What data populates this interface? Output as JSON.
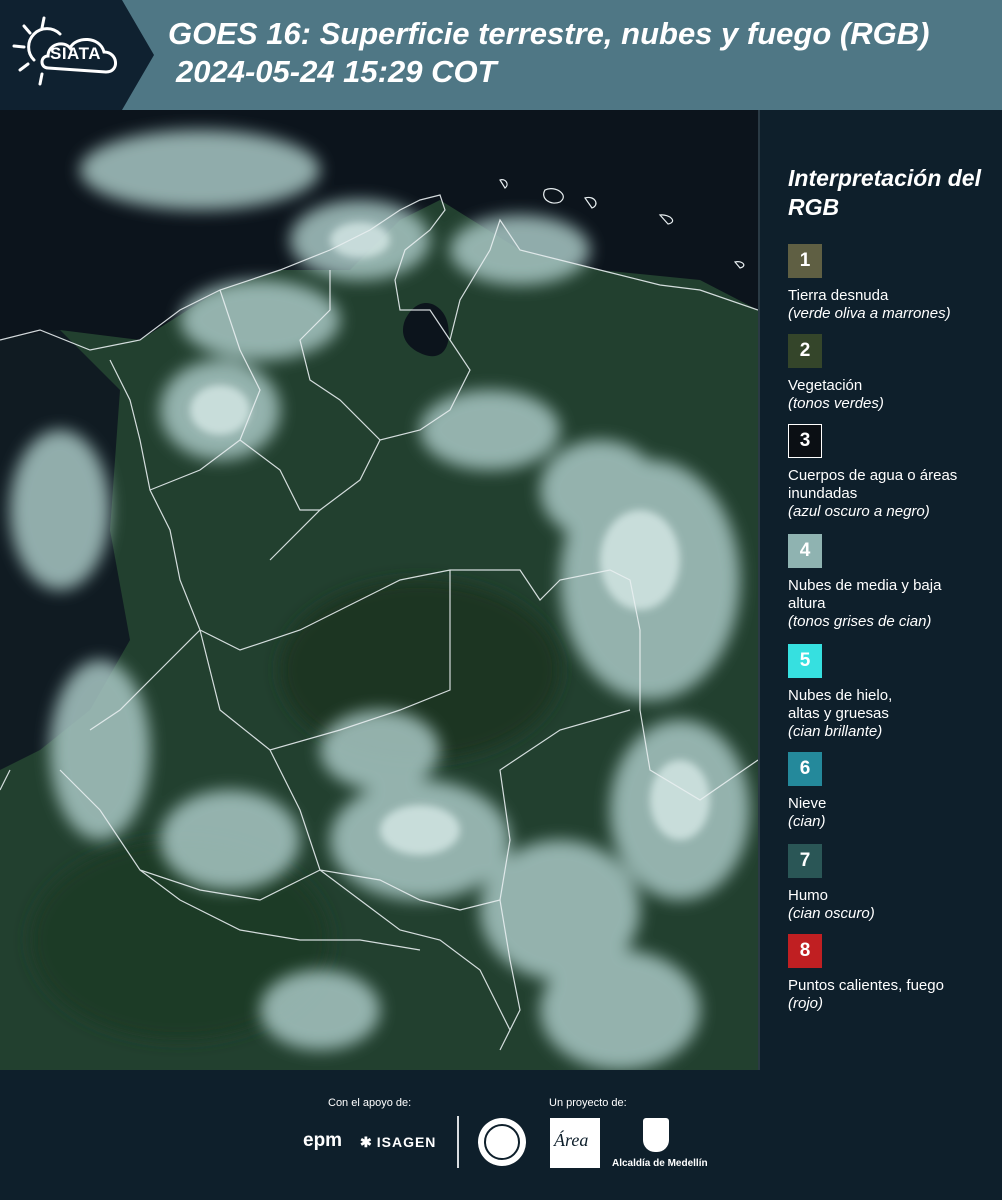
{
  "header": {
    "logo": "SIATA",
    "title": "GOES 16: Superficie terrestre, nubes y fuego (RGB)",
    "datetime": "2024-05-24 15:29 COT"
  },
  "legend": {
    "title": "Interpretación del RGB",
    "items": [
      {
        "number": "1",
        "label": "Tierra desnuda",
        "hint": "(verde oliva a marrones)",
        "color": "#5f5f43"
      },
      {
        "number": "2",
        "label": "Vegetación",
        "hint": "(tonos verdes)",
        "color": "#34452a"
      },
      {
        "number": "3",
        "label": "Cuerpos de agua o áreas inundadas",
        "hint": "(azul oscuro a negro)",
        "color": "#0b0f14"
      },
      {
        "number": "4",
        "label": "Nubes de media y baja altura",
        "hint": "(tonos grises de cian)",
        "color": "#8fb3b1"
      },
      {
        "number": "5",
        "label": "Nubes de hielo, altas y gruesas",
        "hint": "(cian brillante)",
        "color": "#36e0e0"
      },
      {
        "number": "6",
        "label": "Nieve",
        "hint": "(cian)",
        "color": "#24899b"
      },
      {
        "number": "7",
        "label": "Humo",
        "hint": "(cian oscuro)",
        "color": "#2a5656"
      },
      {
        "number": "8",
        "label": "Puntos calientes, fuego",
        "hint": "(rojo)",
        "color": "#c01f22"
      }
    ]
  },
  "footer": {
    "support_label": "Con el apoyo de:",
    "project_label": "Un proyecto de:",
    "epm": "epm",
    "isagen": "ISAGEN",
    "amva": "Área",
    "alcaldia": "Alcaldía de Medellín"
  }
}
